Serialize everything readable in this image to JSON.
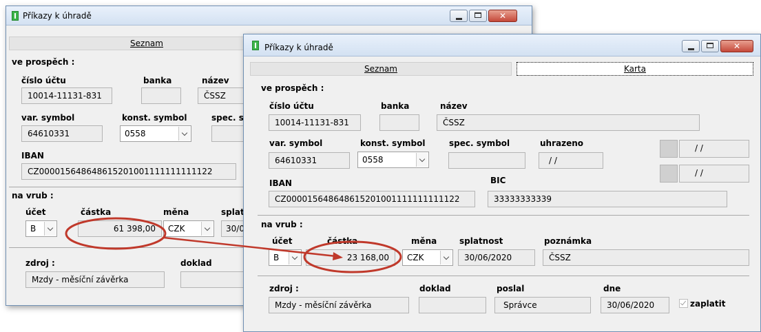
{
  "back": {
    "title": "Příkazy k úhradě",
    "tab_seznam": "Seznam",
    "ve_prospech": "ve prospěch :",
    "lbl_cislo_uctu": "číslo účtu",
    "lbl_banka": "banka",
    "lbl_nazev": "název",
    "cislo_uctu": "10014-11131-831",
    "banka": "",
    "nazev": "ČSSZ",
    "lbl_var_symbol": "var. symbol",
    "lbl_konst_symbol": "konst. symbol",
    "lbl_spec_symbol": "spec. s",
    "var_symbol": "64610331",
    "konst_symbol": "0558",
    "lbl_iban": "IBAN",
    "iban": "CZ000015648648615201001111111111122",
    "na_vrub": "na vrub :",
    "lbl_ucet": "účet",
    "lbl_castka": "částka",
    "lbl_mena": "měna",
    "lbl_splat": "splat",
    "ucet": "B",
    "castka": "61 398,00",
    "mena": "CZK",
    "splatnost": "30/0",
    "lbl_zdroj": "zdroj :",
    "lbl_doklad": "doklad",
    "zdroj": "Mzdy - měsíční závěrka"
  },
  "front": {
    "title": "Příkazy k úhradě",
    "tab_seznam": "Seznam",
    "tab_karta": "Karta",
    "ve_prospech": "ve prospěch :",
    "lbl_cislo_uctu": "číslo účtu",
    "lbl_banka": "banka",
    "lbl_nazev": "název",
    "cislo_uctu": "10014-11131-831",
    "banka": "",
    "nazev": "ČSSZ",
    "lbl_var_symbol": "var. symbol",
    "lbl_konst_symbol": "konst. symbol",
    "lbl_spec_symbol": "spec. symbol",
    "lbl_uhrazeno": "uhrazeno",
    "var_symbol": "64610331",
    "konst_symbol": "0558",
    "spec_symbol": "",
    "uhrazeno": "/ /",
    "date_a": "/ /",
    "date_b": "/ /",
    "lbl_iban": "IBAN",
    "lbl_bic": "BIC",
    "iban": "CZ000015648648615201001111111111122",
    "bic": "33333333339",
    "na_vrub": "na vrub :",
    "lbl_ucet": "účet",
    "lbl_castka": "částka",
    "lbl_mena": "měna",
    "lbl_splatnost": "splatnost",
    "lbl_poznamka": "poznámka",
    "ucet": "B",
    "castka": "23 168,00",
    "mena": "CZK",
    "splatnost": "30/06/2020",
    "poznamka": "ČSSZ",
    "lbl_zdroj": "zdroj :",
    "lbl_doklad": "doklad",
    "lbl_poslal": "poslal",
    "lbl_dne": "dne",
    "zdroj": "Mzdy - měsíční závěrka",
    "doklad": "",
    "poslal": "Správce",
    "dne": "30/06/2020",
    "zaplatit": "zaplatit"
  },
  "colors": {
    "annotation": "#c0392b"
  }
}
